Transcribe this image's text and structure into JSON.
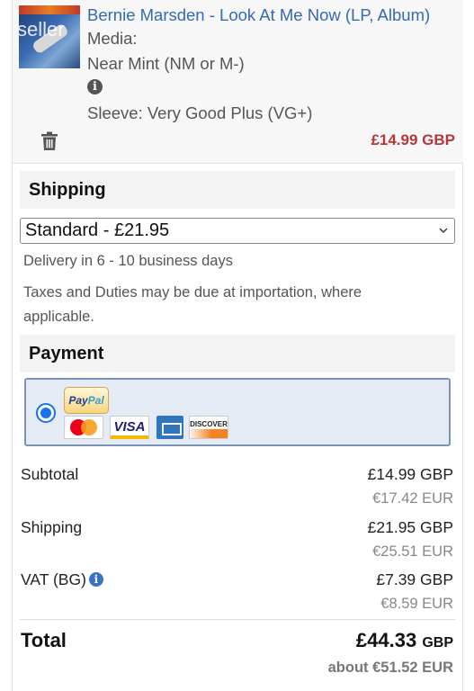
{
  "item": {
    "thumb_watermark": "seller",
    "title": "Bernie Marsden - Look At Me Now (LP, Album)",
    "media_label": "Media:",
    "media_condition": "Near Mint (NM or M-)",
    "sleeve": "Sleeve: Very Good Plus (VG+)",
    "price": "£14.99 GBP"
  },
  "shipping": {
    "heading": "Shipping",
    "selected_option": "Standard - £21.95",
    "delivery": "Delivery in 6 - 10 business days",
    "taxes_note": "Taxes and Duties may be due at importation, where applicable."
  },
  "payment": {
    "heading": "Payment",
    "paypal_label_a": "Pay",
    "paypal_label_b": "Pal",
    "visa_label": "VISA",
    "discover_label": "DISCOVER"
  },
  "totals": {
    "subtotal_label": "Subtotal",
    "subtotal_gbp": "£14.99 GBP",
    "subtotal_eur": "€17.42 EUR",
    "shipping_label": "Shipping",
    "shipping_gbp": "£21.95 GBP",
    "shipping_eur": "€25.51 EUR",
    "vat_label": "VAT (BG)",
    "vat_gbp": "£7.39 GBP",
    "vat_eur": "€8.59 EUR",
    "total_label": "Total",
    "total_gbp_amount": "£44.33",
    "total_gbp_currency": "GBP",
    "total_eur": "about €51.52 EUR"
  },
  "colors": {
    "link": "#3469b4",
    "price_red": "#b5373a",
    "payment_selected_bg": "#e4ebf5"
  },
  "icons": [
    "info-icon",
    "trash-icon",
    "chevron-down-icon",
    "radio-selected-icon"
  ]
}
